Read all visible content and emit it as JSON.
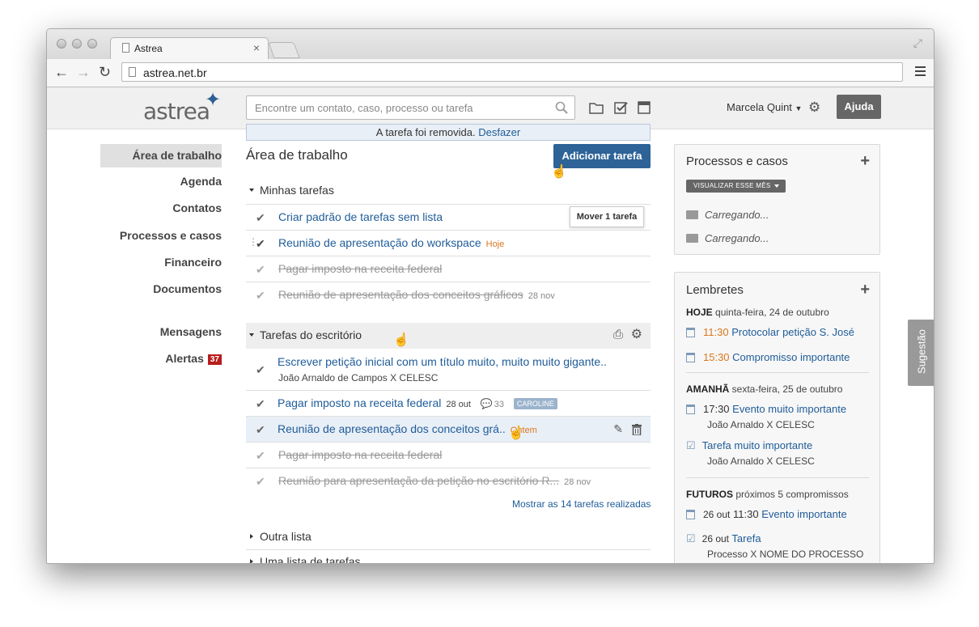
{
  "browser": {
    "tab_title": "Astrea",
    "url": "astrea.net.br"
  },
  "header": {
    "logo": "astrea",
    "search_placeholder": "Encontre um contato, caso, processo ou tarefa",
    "user_name": "Marcela Quint",
    "help_label": "Ajuda"
  },
  "toast": {
    "message": "A tarefa foi removida.",
    "undo": "Desfazer"
  },
  "sidebar": {
    "items": [
      {
        "label": "Área de trabalho"
      },
      {
        "label": "Agenda"
      },
      {
        "label": "Contatos"
      },
      {
        "label": "Processos e casos"
      },
      {
        "label": "Financeiro"
      },
      {
        "label": "Documentos"
      },
      {
        "label": "Mensagens"
      },
      {
        "label": "Alertas",
        "badge": "37"
      }
    ]
  },
  "main": {
    "title": "Área de trabalho",
    "add_task_label": "Adicionar tarefa",
    "move_tooltip": "Mover 1 tarefa",
    "my_tasks": {
      "title": "Minhas tarefas",
      "tasks": [
        {
          "label": "Criar padrão de tarefas sem lista"
        },
        {
          "label": "Reunião de apresentação do workspace",
          "tag": "Hoje"
        },
        {
          "label": "Pagar imposto na receita federal"
        },
        {
          "label": "Reunião de apresentação dos conceitos gráficos",
          "date": "28 nov"
        }
      ]
    },
    "office_tasks": {
      "title": "Tarefas do escritório",
      "tasks": [
        {
          "label": "Escrever petição inicial com um título muito, muito muito gigante..",
          "sub": "João Arnaldo de Campos X CELESC"
        },
        {
          "label": "Pagar imposto na receita federal",
          "date": "28 out",
          "comments": "33",
          "user": "CAROLINE"
        },
        {
          "label": "Reunião de apresentação dos conceitos grá..",
          "tag": "Ontem"
        },
        {
          "label": "Pagar imposto na receita federal"
        },
        {
          "label": "Reunião para apresentação da petição no escritório R...",
          "date": "28 nov"
        }
      ],
      "show_done": "Mostrar as 14 tarefas realizadas"
    },
    "other_lists": [
      "Outra lista",
      "Uma lista de tarefas"
    ]
  },
  "processes_panel": {
    "title": "Processos e casos",
    "view_button": "VISUALIZAR ESSE MÊS",
    "items": [
      "Carregando...",
      "Carregando..."
    ]
  },
  "reminders": {
    "title": "Lembretes",
    "today": {
      "head": "HOJE",
      "date": "quinta-feira, 24 de outubro"
    },
    "today_items": [
      {
        "time": "11:30",
        "label": "Protocolar petição S. José"
      },
      {
        "time": "15:30",
        "label": "Compromisso importante"
      }
    ],
    "tomorrow": {
      "head": "AMANHÃ",
      "date": "sexta-feira, 25 de outubro"
    },
    "tomorrow_items": [
      {
        "time": "17:30",
        "label": "Evento muito importante",
        "sub": "João Arnaldo X CELESC"
      },
      {
        "label": "Tarefa muito importante",
        "sub": "João Arnaldo X CELESC"
      }
    ],
    "future": {
      "head": "FUTUROS",
      "date": "próximos 5 compromissos"
    },
    "future_items": [
      {
        "day": "26 out",
        "time": "11:30",
        "label": "Evento importante"
      },
      {
        "day": "26 out",
        "label": "Tarefa",
        "sub": "Processo X NOME DO PROCESSO"
      }
    ]
  },
  "feedback_tab": "Sugestão"
}
